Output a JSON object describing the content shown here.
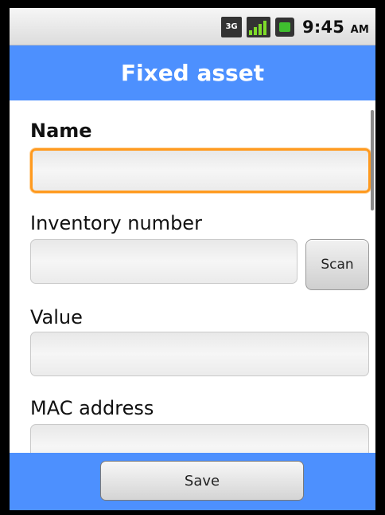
{
  "status_bar": {
    "network_label": "3G",
    "time": "9:45",
    "ampm": "AM"
  },
  "header": {
    "title": "Fixed asset"
  },
  "form": {
    "name_label": "Name",
    "inventory_label": "Inventory number",
    "scan_label": "Scan",
    "value_label": "Value",
    "mac_label": "MAC address"
  },
  "footer": {
    "save_label": "Save"
  },
  "colors": {
    "accent": "#4d90fe",
    "focus": "#ff9a1f"
  }
}
